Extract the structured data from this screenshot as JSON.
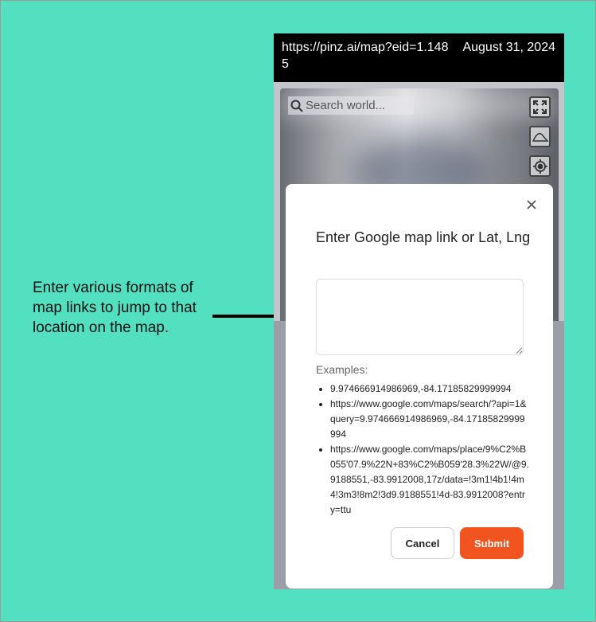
{
  "annotation": {
    "text": "Enter various formats of map links to jump to that location on the map."
  },
  "statusbar": {
    "url": "https://pinz.ai/map?eid=1.1485",
    "date": "August 31, 2024"
  },
  "map": {
    "search_placeholder": "Search world..."
  },
  "modal": {
    "title": "Enter Google map link or Lat, Lng",
    "input_value": "",
    "examples_label": "Examples:",
    "examples": [
      "9.974666914986969,-84.17185829999994",
      "https://www.google.com/maps/search/?api=1&query=9.974666914986969,-84.17185829999994",
      "https://www.google.com/maps/place/9%C2%B055'07.9%22N+83%C2%B059'28.3%22W/@9.9188551,-83.9912008,17z/data=!3m1!4b1!4m4!3m3!8m2!3d9.9188551!4d-83.9912008?entry=ttu"
    ],
    "cancel_label": "Cancel",
    "submit_label": "Submit"
  },
  "colors": {
    "background": "#52e0c1",
    "submit": "#f2541f"
  }
}
